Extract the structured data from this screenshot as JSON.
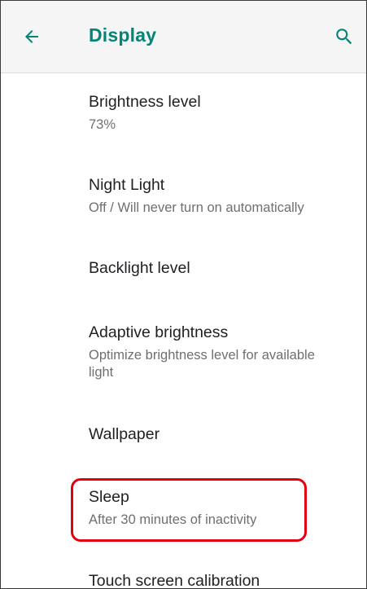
{
  "header": {
    "title": "Display",
    "back_icon": "arrow-left-icon",
    "search_icon": "search-icon",
    "accent_color": "#008577"
  },
  "settings": [
    {
      "title": "Brightness level",
      "subtitle": "73%"
    },
    {
      "title": "Night Light",
      "subtitle": "Off / Will never turn on automatically"
    },
    {
      "title": "Backlight level",
      "subtitle": ""
    },
    {
      "title": "Adaptive brightness",
      "subtitle": "Optimize brightness level for available light"
    },
    {
      "title": "Wallpaper",
      "subtitle": ""
    },
    {
      "title": "Sleep",
      "subtitle": "After 30 minutes of inactivity"
    },
    {
      "title": "Touch screen calibration",
      "subtitle": ""
    }
  ],
  "highlight_color": "#e3000f"
}
